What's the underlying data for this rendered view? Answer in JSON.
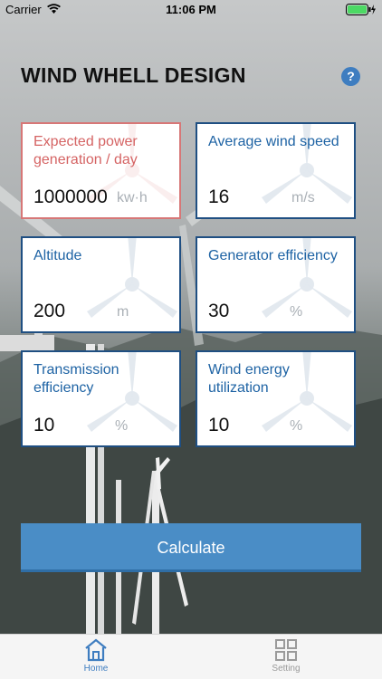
{
  "status_bar": {
    "carrier": "Carrier",
    "time": "11:06 PM"
  },
  "header": {
    "title": "WIND WHELL DESIGN",
    "help_icon": "?"
  },
  "cards": [
    {
      "label": "Expected power generation / day",
      "value": "1000000",
      "unit": "kw·h",
      "active": true
    },
    {
      "label": "Average wind speed",
      "value": "16",
      "unit": "m/s",
      "active": false
    },
    {
      "label": "Altitude",
      "value": "200",
      "unit": "m",
      "active": false
    },
    {
      "label": "Generator efficiency",
      "value": "30",
      "unit": "%",
      "active": false
    },
    {
      "label": "Transmission efficiency",
      "value": "10",
      "unit": "%",
      "active": false
    },
    {
      "label": "Wind energy utilization",
      "value": "10",
      "unit": "%",
      "active": false
    }
  ],
  "calculate_label": "Calculate",
  "tabs": [
    {
      "label": "Home",
      "icon": "home-icon",
      "active": true
    },
    {
      "label": "Setting",
      "icon": "grid-icon",
      "active": false
    }
  ],
  "colors": {
    "accent": "#3e7dc0",
    "card_border": "#1f4f82",
    "active_border": "#d77777"
  }
}
